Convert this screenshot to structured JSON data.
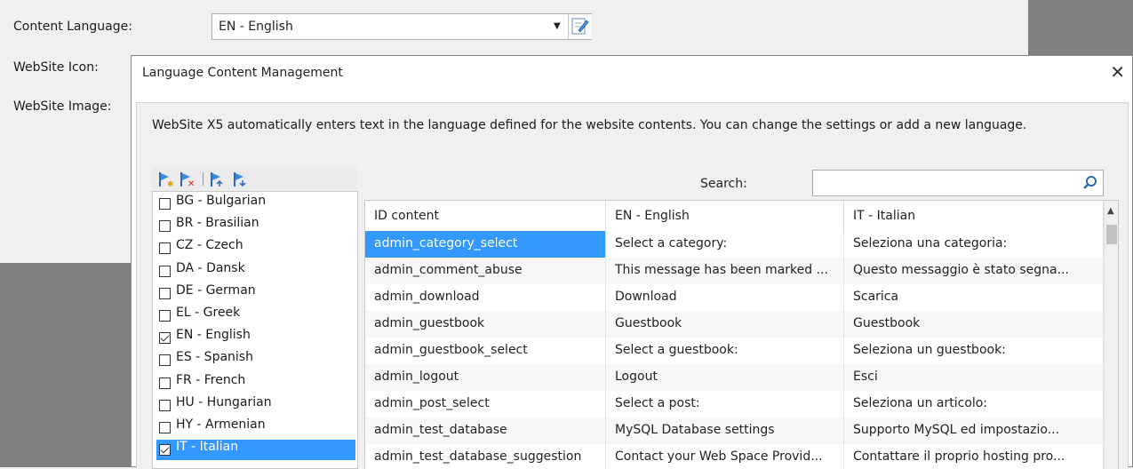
{
  "form": {
    "content_language_label": "Content Language:",
    "content_language_value": "EN - English",
    "website_icon_label": "WebSite Icon:",
    "website_image_label": "WebSite Image:"
  },
  "dialog": {
    "title": "Language Content Management",
    "close": "✕",
    "description": "WebSite X5 automatically enters text in the language defined for the website contents. You can change the settings or add a new language.",
    "search_label": "Search:",
    "search_value": "",
    "toolbar_icons": [
      "add-language-icon",
      "remove-language-icon",
      "import-language-icon",
      "export-language-icon"
    ]
  },
  "languages": [
    {
      "label": "BG - Bulgarian",
      "checked": false,
      "selected": false
    },
    {
      "label": "BR - Brasilian",
      "checked": false,
      "selected": false
    },
    {
      "label": "CZ - Czech",
      "checked": false,
      "selected": false
    },
    {
      "label": "DA - Dansk",
      "checked": false,
      "selected": false
    },
    {
      "label": "DE - German",
      "checked": false,
      "selected": false
    },
    {
      "label": "EL - Greek",
      "checked": false,
      "selected": false
    },
    {
      "label": "EN - English",
      "checked": true,
      "selected": false
    },
    {
      "label": "ES - Spanish",
      "checked": false,
      "selected": false
    },
    {
      "label": "FR - French",
      "checked": false,
      "selected": false
    },
    {
      "label": "HU - Hungarian",
      "checked": false,
      "selected": false
    },
    {
      "label": "HY - Armenian",
      "checked": false,
      "selected": false
    },
    {
      "label": "IT - Italian",
      "checked": true,
      "selected": true
    }
  ],
  "table": {
    "columns": [
      "ID content",
      "EN - English",
      "IT - Italian"
    ],
    "rows": [
      [
        "admin_category_select",
        "Select a category:",
        "Seleziona una categoria:"
      ],
      [
        "admin_comment_abuse",
        "This message has been marked ...",
        "Questo messaggio è stato segna..."
      ],
      [
        "admin_download",
        "Download",
        "Scarica"
      ],
      [
        "admin_guestbook",
        "Guestbook",
        "Guestbook"
      ],
      [
        "admin_guestbook_select",
        "Select a guestbook:",
        "Seleziona un guestbook:"
      ],
      [
        "admin_logout",
        "Logout",
        "Esci"
      ],
      [
        "admin_post_select",
        "Select a post:",
        "Seleziona un articolo:"
      ],
      [
        "admin_test_database",
        "MySQL Database settings",
        "Supporto MySQL ed impostazio..."
      ],
      [
        "admin_test_database_suggestion",
        "Contact your Web Space Provid...",
        "Contattare il proprio hosting pro..."
      ]
    ],
    "selected_row": 0
  },
  "colors": {
    "selection": "#3399ff",
    "backdrop": "#808080"
  }
}
